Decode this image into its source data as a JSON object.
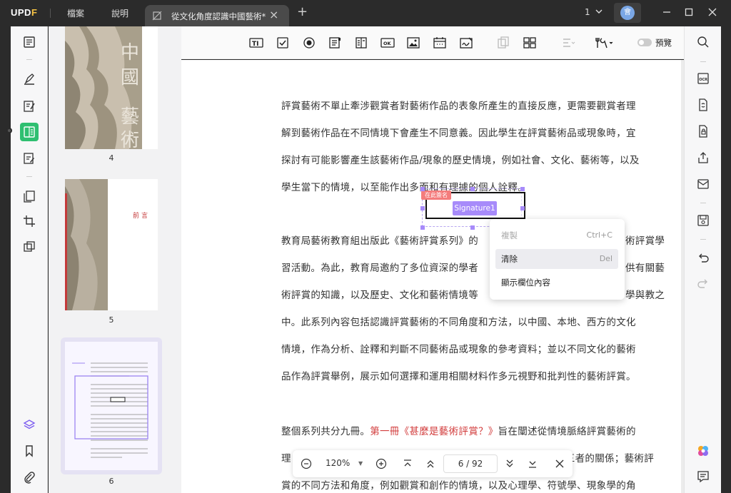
{
  "titlebar": {
    "logo": "UPDF",
    "menu_file": "檔案",
    "menu_help": "說明",
    "tab_title": "從文化角度認識中國藝術*",
    "page_indicator": "1",
    "avatar_initial": "會"
  },
  "toolbar": {
    "preview_label": "預覽",
    "tools": [
      "text-field-icon",
      "checkbox-icon",
      "radio-button-icon",
      "combo-box-icon",
      "list-box-icon",
      "button-icon",
      "image-field-icon",
      "date-field-icon",
      "signature-field-icon",
      "copy-icon",
      "grid-icon",
      "align-icon",
      "tools-icon"
    ]
  },
  "thumbnails": [
    {
      "label": "4"
    },
    {
      "label": "5",
      "heading": "前言"
    },
    {
      "label": "6",
      "selected": true
    }
  ],
  "document": {
    "paragraph1": [
      "評賞藝術不單止牽涉觀賞者對藝術作品的表象所產生的直接反應，更需要觀賞者理",
      "解到藝術作品在不同情境下會產生不同意義。因此學生在評賞藝術品或現象時，宜",
      "探討有可能影響產生該藝術作品/現象的歷史情境，例如社會、文化、藝術等，以及",
      "學生當下的情境，以至能作出多面和有理據的個人詮釋。"
    ],
    "paragraph2": [
      "教育局藝術教育組出版此《藝術評賞系列》的",
      "習活動。為此，教育局邀約了多位資深的學者",
      "術評賞的知識，以及歷史、文化和藝術情境等",
      "中。此系列內容包括認識評賞藝術的不同角度和方法，以中國、本地、西方的文化",
      "情境，作為分析、詮釋和判斷不同藝術品或現象的參考資料；並以不同文化的藝術",
      "品作為評賞舉例，展示如何選擇和運用相關材料作多元視野和批判性的藝術評賞。"
    ],
    "paragraph2_right": [
      "術評賞學",
      "供有關藝",
      "學與教之"
    ],
    "paragraph3_line1_pre": "整個系列共分九冊。",
    "paragraph3_line1_red": "第一冊《甚麼是藝術評賞？》",
    "paragraph3_line1_post": "旨在闡述從情境脈絡評賞藝術的",
    "paragraph3_line2_pre": "理",
    "paragraph3_line2_post": "三者的關係；藝術評",
    "paragraph3_line3": "賞的不同方法和角度，例如觀賞和創作的情境，以及心理學、符號學、現象學的角"
  },
  "signature_field": {
    "label": "Signature1",
    "hint": "在此簽名"
  },
  "context_menu": {
    "items": [
      {
        "label": "複製",
        "shortcut": "Ctrl+C",
        "disabled": true
      },
      {
        "label": "清除",
        "shortcut": "Del",
        "disabled": false
      },
      {
        "label": "顯示欄位內容",
        "shortcut": "",
        "disabled": false
      }
    ]
  },
  "navbar": {
    "zoom": "120%",
    "page": "6 / 92"
  },
  "colors": {
    "accent": "#2fbf71",
    "field": "#a78bfa",
    "highlight_red": "#d23c3c"
  }
}
